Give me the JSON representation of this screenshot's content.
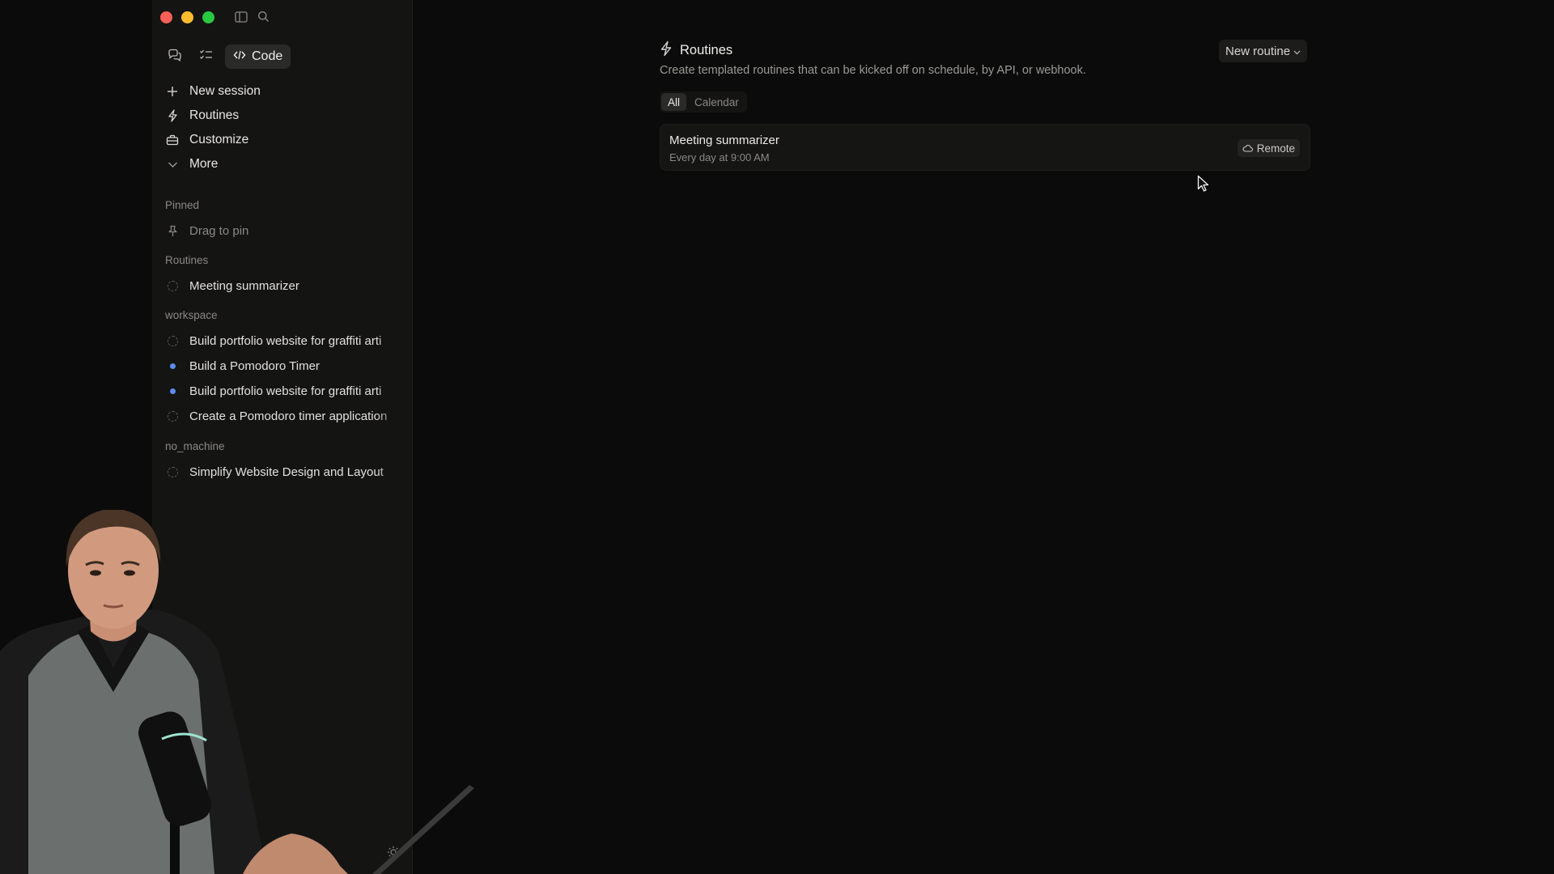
{
  "window": {
    "traffic_lights": [
      "close",
      "minimize",
      "maximize"
    ]
  },
  "mode_bar": {
    "chat_icon": "chat-bubbles-icon",
    "tasks_icon": "checklist-icon",
    "code_label": "Code"
  },
  "nav": {
    "items": [
      {
        "label": "New session",
        "icon": "plus-icon"
      },
      {
        "label": "Routines",
        "icon": "bolt-icon"
      },
      {
        "label": "Customize",
        "icon": "briefcase-icon"
      },
      {
        "label": "More",
        "icon": "chevron-down-icon"
      }
    ]
  },
  "pinned": {
    "label": "Pinned",
    "placeholder": "Drag to pin"
  },
  "routines_section": {
    "label": "Routines",
    "items": [
      {
        "title": "Meeting summarizer",
        "status": "idle"
      }
    ]
  },
  "workspace": {
    "label": "workspace",
    "items": [
      {
        "title": "Build portfolio website for graffiti arti",
        "status": "idle"
      },
      {
        "title": "Build a Pomodoro Timer",
        "status": "active"
      },
      {
        "title": "Build portfolio website for graffiti arti",
        "status": "active"
      },
      {
        "title": "Create a Pomodoro timer application",
        "status": "idle"
      }
    ]
  },
  "no_machine": {
    "label": "no_machine",
    "items": [
      {
        "title": "Simplify Website Design and Layout",
        "status": "idle"
      }
    ]
  },
  "main": {
    "title": "Routines",
    "subtitle": "Create templated routines that can be kicked off on schedule, by API, or webhook.",
    "new_button": "New routine",
    "tabs": [
      {
        "label": "All",
        "active": true
      },
      {
        "label": "Calendar",
        "active": false
      }
    ],
    "routines": [
      {
        "name": "Meeting summarizer",
        "schedule": "Every day at 9:00 AM",
        "badge": "Remote"
      }
    ]
  },
  "colors": {
    "background": "#0b0b0b",
    "sidebar": "#141413",
    "accent_blue": "#5b8def",
    "text_primary": "#e8e6e3",
    "text_muted": "#8b8984"
  }
}
